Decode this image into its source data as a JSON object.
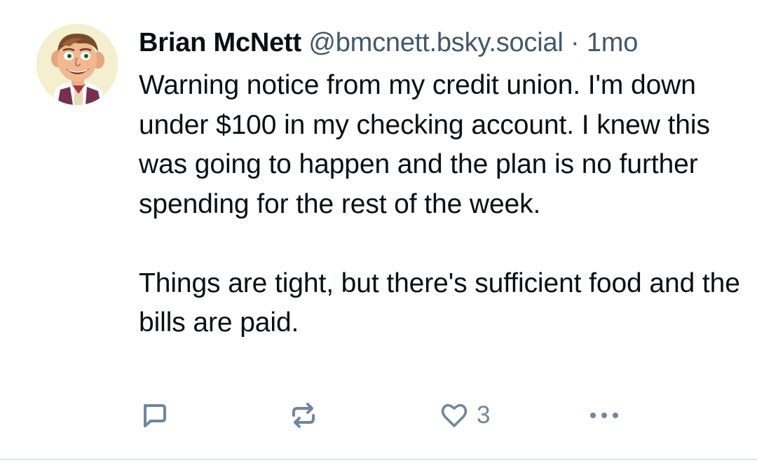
{
  "post": {
    "author_name": "Brian McNett",
    "author_handle": "@bmcnett.bsky.social",
    "separator": "·",
    "age": "1mo",
    "body_paragraphs": [
      "Warning notice from my credit union. I'm down under $100 in my checking account. I knew this was going to happen and the plan is no further spending for the rest of the week.",
      "Things are tight, but there's sufficient food and the bills are paid."
    ],
    "like_count": "3"
  },
  "icons": {
    "reply": "speech-bubble-icon",
    "repost": "repost-arrows-icon",
    "like": "heart-outline-icon",
    "more": "ellipsis-icon"
  },
  "colors": {
    "text": "#0b0f14",
    "muted": "#42576c",
    "action": "#6f869f",
    "divider": "#dde3ea"
  }
}
